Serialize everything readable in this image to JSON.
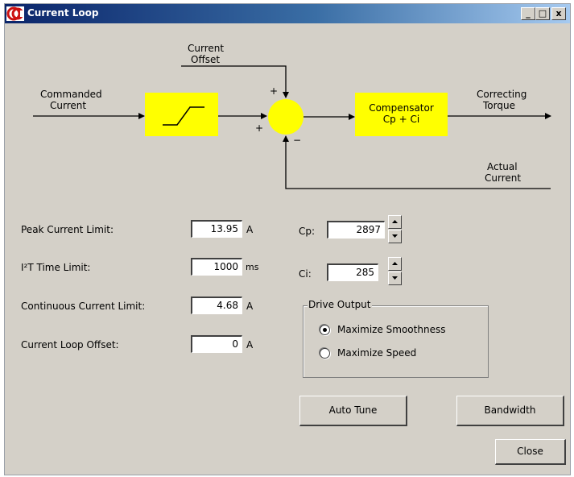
{
  "window": {
    "title": "Current Loop",
    "controls": {
      "minimize": "_",
      "maximize": "□",
      "close": "x"
    }
  },
  "diagram": {
    "current_offset_line1": "Current",
    "current_offset_line2": "Offset",
    "commanded_line1": "Commanded",
    "commanded_line2": "Current",
    "plus_top": "+",
    "plus_left": "+",
    "minus_bottom": "−",
    "compensator_line1": "Compensator",
    "compensator_line2": "Cp + Ci",
    "correcting_line1": "Correcting",
    "correcting_line2": "Torque",
    "actual_line1": "Actual",
    "actual_line2": "Current",
    "block_color": "#ffff00"
  },
  "params": {
    "peak_label": "Peak Current Limit:",
    "peak_value": "13.95",
    "peak_unit": "A",
    "i2t_label": "I²T Time Limit:",
    "i2t_value": "1000",
    "i2t_unit": "ms",
    "continuous_label": "Continuous Current Limit:",
    "continuous_value": "4.68",
    "continuous_unit": "A",
    "offset_label": "Current Loop Offset:",
    "offset_value": "0",
    "offset_unit": "A"
  },
  "gains": {
    "cp_label": "Cp:",
    "cp_value": "2897",
    "ci_label": "Ci:",
    "ci_value": "285"
  },
  "drive_output": {
    "title": "Drive Output",
    "options": [
      {
        "label": "Maximize Smoothness",
        "selected": true
      },
      {
        "label": "Maximize Speed",
        "selected": false
      }
    ]
  },
  "buttons": {
    "auto_tune": "Auto Tune",
    "bandwidth": "Bandwidth",
    "close": "Close"
  }
}
